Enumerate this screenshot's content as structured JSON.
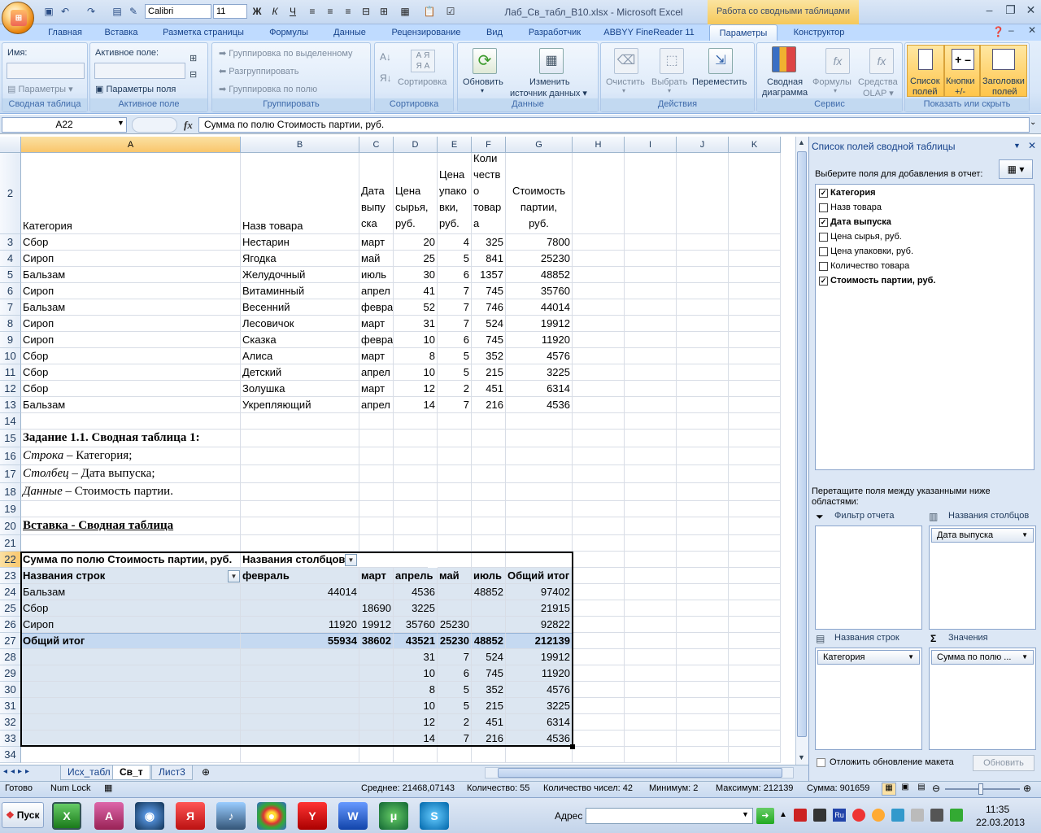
{
  "window": {
    "title": "Лаб_Св_табл_В10.xlsx - Microsoft Excel",
    "context_tab_group": "Работа со сводными таблицами",
    "qat": {
      "font": "Calibri",
      "size": "11"
    }
  },
  "ribbon": {
    "tabs": [
      "Главная",
      "Вставка",
      "Разметка страницы",
      "Формулы",
      "Данные",
      "Рецензирование",
      "Вид",
      "Разработчик",
      "ABBYY FineReader 11",
      "Параметры",
      "Конструктор"
    ],
    "groups": {
      "pivot": {
        "name_label": "Имя:",
        "options_label": "Параметры",
        "group_label": "Сводная таблица"
      },
      "active_field": {
        "label": "Активное поле:",
        "field_params": "Параметры поля",
        "group_label": "Активное поле"
      },
      "group": {
        "by_selection": "Группировка по выделенному",
        "ungroup": "Разгруппировать",
        "by_field": "Группировка по полю",
        "group_label": "Группировать"
      },
      "sort": {
        "sort_label": "Сортировка",
        "group_label": "Сортировка"
      },
      "data": {
        "refresh": "Обновить",
        "change_source_1": "Изменить",
        "change_source_2": "источник данных",
        "group_label": "Данные"
      },
      "actions": {
        "clear": "Очистить",
        "select": "Выбрать",
        "move": "Переместить",
        "group_label": "Действия"
      },
      "tools": {
        "pivot_chart_1": "Сводная",
        "pivot_chart_2": "диаграмма",
        "formulas": "Формулы",
        "olap_1": "Средства",
        "olap_2": "OLAP",
        "group_label": "Сервис"
      },
      "show_hide": {
        "field_list_1": "Список",
        "field_list_2": "полей",
        "buttons_1": "Кнопки",
        "buttons_2": "+/-",
        "headers_1": "Заголовки",
        "headers_2": "полей",
        "group_label": "Показать или скрыть"
      }
    }
  },
  "formula_bar": {
    "name_box": "A22",
    "fx": "fx",
    "formula": "Сумма по полю  Стоимость партии, руб."
  },
  "sheet": {
    "columns": [
      "A",
      "B",
      "C",
      "D",
      "E",
      "F",
      "G",
      "H",
      "I",
      "J",
      "K"
    ],
    "header_row": {
      "row": "2",
      "a": "Категория",
      "b": "Назв товара",
      "c": [
        "Дата",
        "выпу",
        "ска"
      ],
      "d": [
        "Цена",
        "сырья,",
        "руб."
      ],
      "e": [
        "Цена",
        "упако",
        "вки,",
        "руб."
      ],
      "f": [
        "Коли",
        "честв",
        "о",
        "товар",
        "а"
      ],
      "g": [
        "Стоимость",
        "партии,",
        "руб."
      ]
    },
    "data_rows": [
      {
        "row": "3",
        "a": "Сбор",
        "b": "Нестарин",
        "c": "март",
        "d": "20",
        "e": "4",
        "f": "325",
        "g": "7800"
      },
      {
        "row": "4",
        "a": "Сироп",
        "b": "Ягодка",
        "c": "май",
        "d": "25",
        "e": "5",
        "f": "841",
        "g": "25230"
      },
      {
        "row": "5",
        "a": "Бальзам",
        "b": "Желудочный",
        "c": "июль",
        "d": "30",
        "e": "6",
        "f": "1357",
        "g": "48852"
      },
      {
        "row": "6",
        "a": "Сироп",
        "b": "Витаминный",
        "c": "апрел",
        "d": "41",
        "e": "7",
        "f": "745",
        "g": "35760"
      },
      {
        "row": "7",
        "a": "Бальзам",
        "b": "Весенний",
        "c": "февра",
        "d": "52",
        "e": "7",
        "f": "746",
        "g": "44014"
      },
      {
        "row": "8",
        "a": "Сироп",
        "b": "Лесовичок",
        "c": "март",
        "d": "31",
        "e": "7",
        "f": "524",
        "g": "19912"
      },
      {
        "row": "9",
        "a": "Сироп",
        "b": "Сказка",
        "c": "февра",
        "d": "10",
        "e": "6",
        "f": "745",
        "g": "11920"
      },
      {
        "row": "10",
        "a": "Сбор",
        "b": "Алиса",
        "c": "март",
        "d": "8",
        "e": "5",
        "f": "352",
        "g": "4576"
      },
      {
        "row": "11",
        "a": "Сбор",
        "b": "Детский",
        "c": "апрел",
        "d": "10",
        "e": "5",
        "f": "215",
        "g": "3225"
      },
      {
        "row": "12",
        "a": "Сбор",
        "b": "Золушка",
        "c": "март",
        "d": "12",
        "e": "2",
        "f": "451",
        "g": "6314"
      },
      {
        "row": "13",
        "a": "Бальзам",
        "b": "Укрепляющий",
        "c": "апрел",
        "d": "14",
        "e": "7",
        "f": "216",
        "g": "4536"
      }
    ],
    "task": {
      "r15": "Задание 1.1. Сводная таблица 1:",
      "r16_i": "Строка",
      "r16_t": " – Категория;",
      "r17_i": "Столбец",
      "r17_t": " – Дата выпуска;",
      "r18_i": "Данные",
      "r18_t": " – Стоимость партии.",
      "r20": "Вставка - Сводная таблица"
    },
    "pivot": {
      "r22_a": "Сумма по полю  Стоимость партии, руб.",
      "r22_b": "Названия столбцов",
      "r23": [
        "Названия строк",
        "февраль",
        "март",
        "апрель",
        "май",
        "июль",
        "Общий итог"
      ],
      "rows": [
        {
          "row": "24",
          "label": "Бальзам",
          "feb": "44014",
          "mar": "",
          "apr": "4536",
          "may": "",
          "jul": "48852",
          "total": "97402"
        },
        {
          "row": "25",
          "label": "Сбор",
          "feb": "",
          "mar": "18690",
          "apr": "3225",
          "may": "",
          "jul": "",
          "total": "21915"
        },
        {
          "row": "26",
          "label": "Сироп",
          "feb": "11920",
          "mar": "19912",
          "apr": "35760",
          "may": "25230",
          "jul": "",
          "total": "92822"
        }
      ],
      "grand": {
        "row": "27",
        "label": "Общий итог",
        "feb": "55934",
        "mar": "38602",
        "apr": "43521",
        "may": "25230",
        "jul": "48852",
        "total": "212139"
      },
      "extra": [
        {
          "row": "28",
          "d": "31",
          "e": "7",
          "f": "524",
          "g": "19912"
        },
        {
          "row": "29",
          "d": "10",
          "e": "6",
          "f": "745",
          "g": "11920"
        },
        {
          "row": "30",
          "d": "8",
          "e": "5",
          "f": "352",
          "g": "4576"
        },
        {
          "row": "31",
          "d": "10",
          "e": "5",
          "f": "215",
          "g": "3225"
        },
        {
          "row": "32",
          "d": "12",
          "e": "2",
          "f": "451",
          "g": "6314"
        },
        {
          "row": "33",
          "d": "14",
          "e": "7",
          "f": "216",
          "g": "4536"
        }
      ]
    },
    "blank_rows": [
      "14",
      "19",
      "21",
      "34"
    ],
    "tabs": [
      "Исх_табл",
      "Св_т",
      "Лист3"
    ]
  },
  "pane": {
    "title": "Список полей сводной таблицы",
    "choose": "Выберите поля для добавления в отчет:",
    "fields": [
      {
        "label": "Категория",
        "checked": true
      },
      {
        "label": "Назв товара",
        "checked": false
      },
      {
        "label": "Дата выпуска",
        "checked": true
      },
      {
        "label": "Цена сырья, руб.",
        "checked": false
      },
      {
        "label": "Цена упаковки, руб.",
        "checked": false
      },
      {
        "label": "Количество товара",
        "checked": false
      },
      {
        "label": "Стоимость партии, руб.",
        "checked": true
      }
    ],
    "drag_hint": "Перетащите поля между указанными ниже областями:",
    "filter": "Фильтр отчета",
    "columns": "Названия столбцов",
    "columns_item": "Дата выпуска",
    "rows": "Названия строк",
    "rows_item": "Категория",
    "values": "Значения",
    "values_item": "Сумма по полю ...",
    "defer": "Отложить обновление макета",
    "update": "Обновить"
  },
  "status": {
    "ready": "Готово",
    "numlock": "Num Lock",
    "avg": "Среднее: 21468,07143",
    "count": "Количество: 55",
    "numcount": "Количество чисел: 42",
    "min": "Минимум: 2",
    "max": "Максимум: 212139",
    "sum": "Сумма: 901659"
  },
  "taskbar": {
    "start": "Пуск",
    "address": "Адрес",
    "time": "11:35",
    "date": "22.03.2013"
  }
}
